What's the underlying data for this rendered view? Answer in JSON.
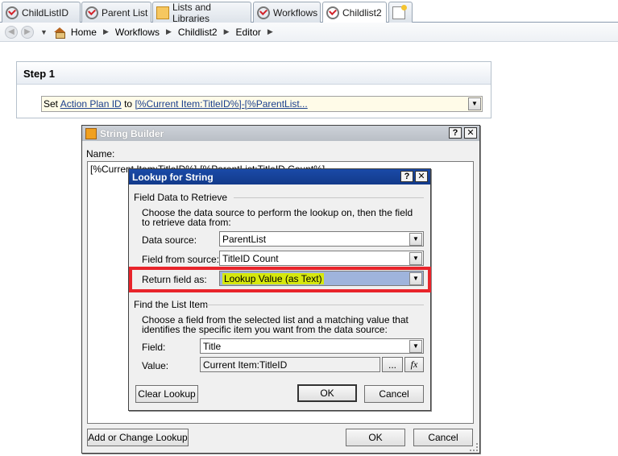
{
  "tabs": [
    {
      "label": "ChildListID",
      "icon": "workflow-icon"
    },
    {
      "label": "Parent List",
      "icon": "workflow-icon"
    },
    {
      "label": "Lists and Libraries",
      "icon": "list-library-icon"
    },
    {
      "label": "Workflows",
      "icon": "workflow-icon"
    },
    {
      "label": "Childlist2",
      "icon": "workflow-icon",
      "active": true
    }
  ],
  "breadcrumb": [
    "Home",
    "Workflows",
    "Childlist2",
    "Editor"
  ],
  "step": {
    "title": "Step 1",
    "action_prefix": "Set",
    "action_field": "Action Plan ID",
    "action_mid": "to",
    "action_value": "[%Current Item:TitleID%]-[%ParentList..."
  },
  "string_builder": {
    "title": "String Builder",
    "name_label": "Name:",
    "name_value": "[%Current Item:TitleID%]-[%ParentList:TitleID Count%]",
    "add_lookup_label": "Add or Change Lookup",
    "ok_label": "OK",
    "cancel_label": "Cancel"
  },
  "lookup": {
    "title": "Lookup for String",
    "section1": "Field Data to Retrieve",
    "section1_desc": "Choose the data source to perform the lookup on, then the field to retrieve data from:",
    "data_source_label": "Data source:",
    "data_source_value": "ParentList",
    "field_from_source_label": "Field from source:",
    "field_from_source_value": "TitleID Count",
    "return_field_label": "Return field as:",
    "return_field_value": "Lookup Value (as Text)",
    "section2": "Find the List Item",
    "section2_desc": "Choose a field from the selected list and a matching value that identifies the specific item you want from the data source:",
    "field_label": "Field:",
    "field_value": "Title",
    "value_label": "Value:",
    "value_value": "Current Item:TitleID",
    "ellipsis_label": "...",
    "fx_label": "fx",
    "clear_lookup_label": "Clear Lookup",
    "ok_label": "OK",
    "cancel_label": "Cancel"
  },
  "colors": {
    "highlight_border": "#e8242b",
    "selection_bg": "#9fb4dc",
    "yellow_highlight": "#d6e80e"
  }
}
